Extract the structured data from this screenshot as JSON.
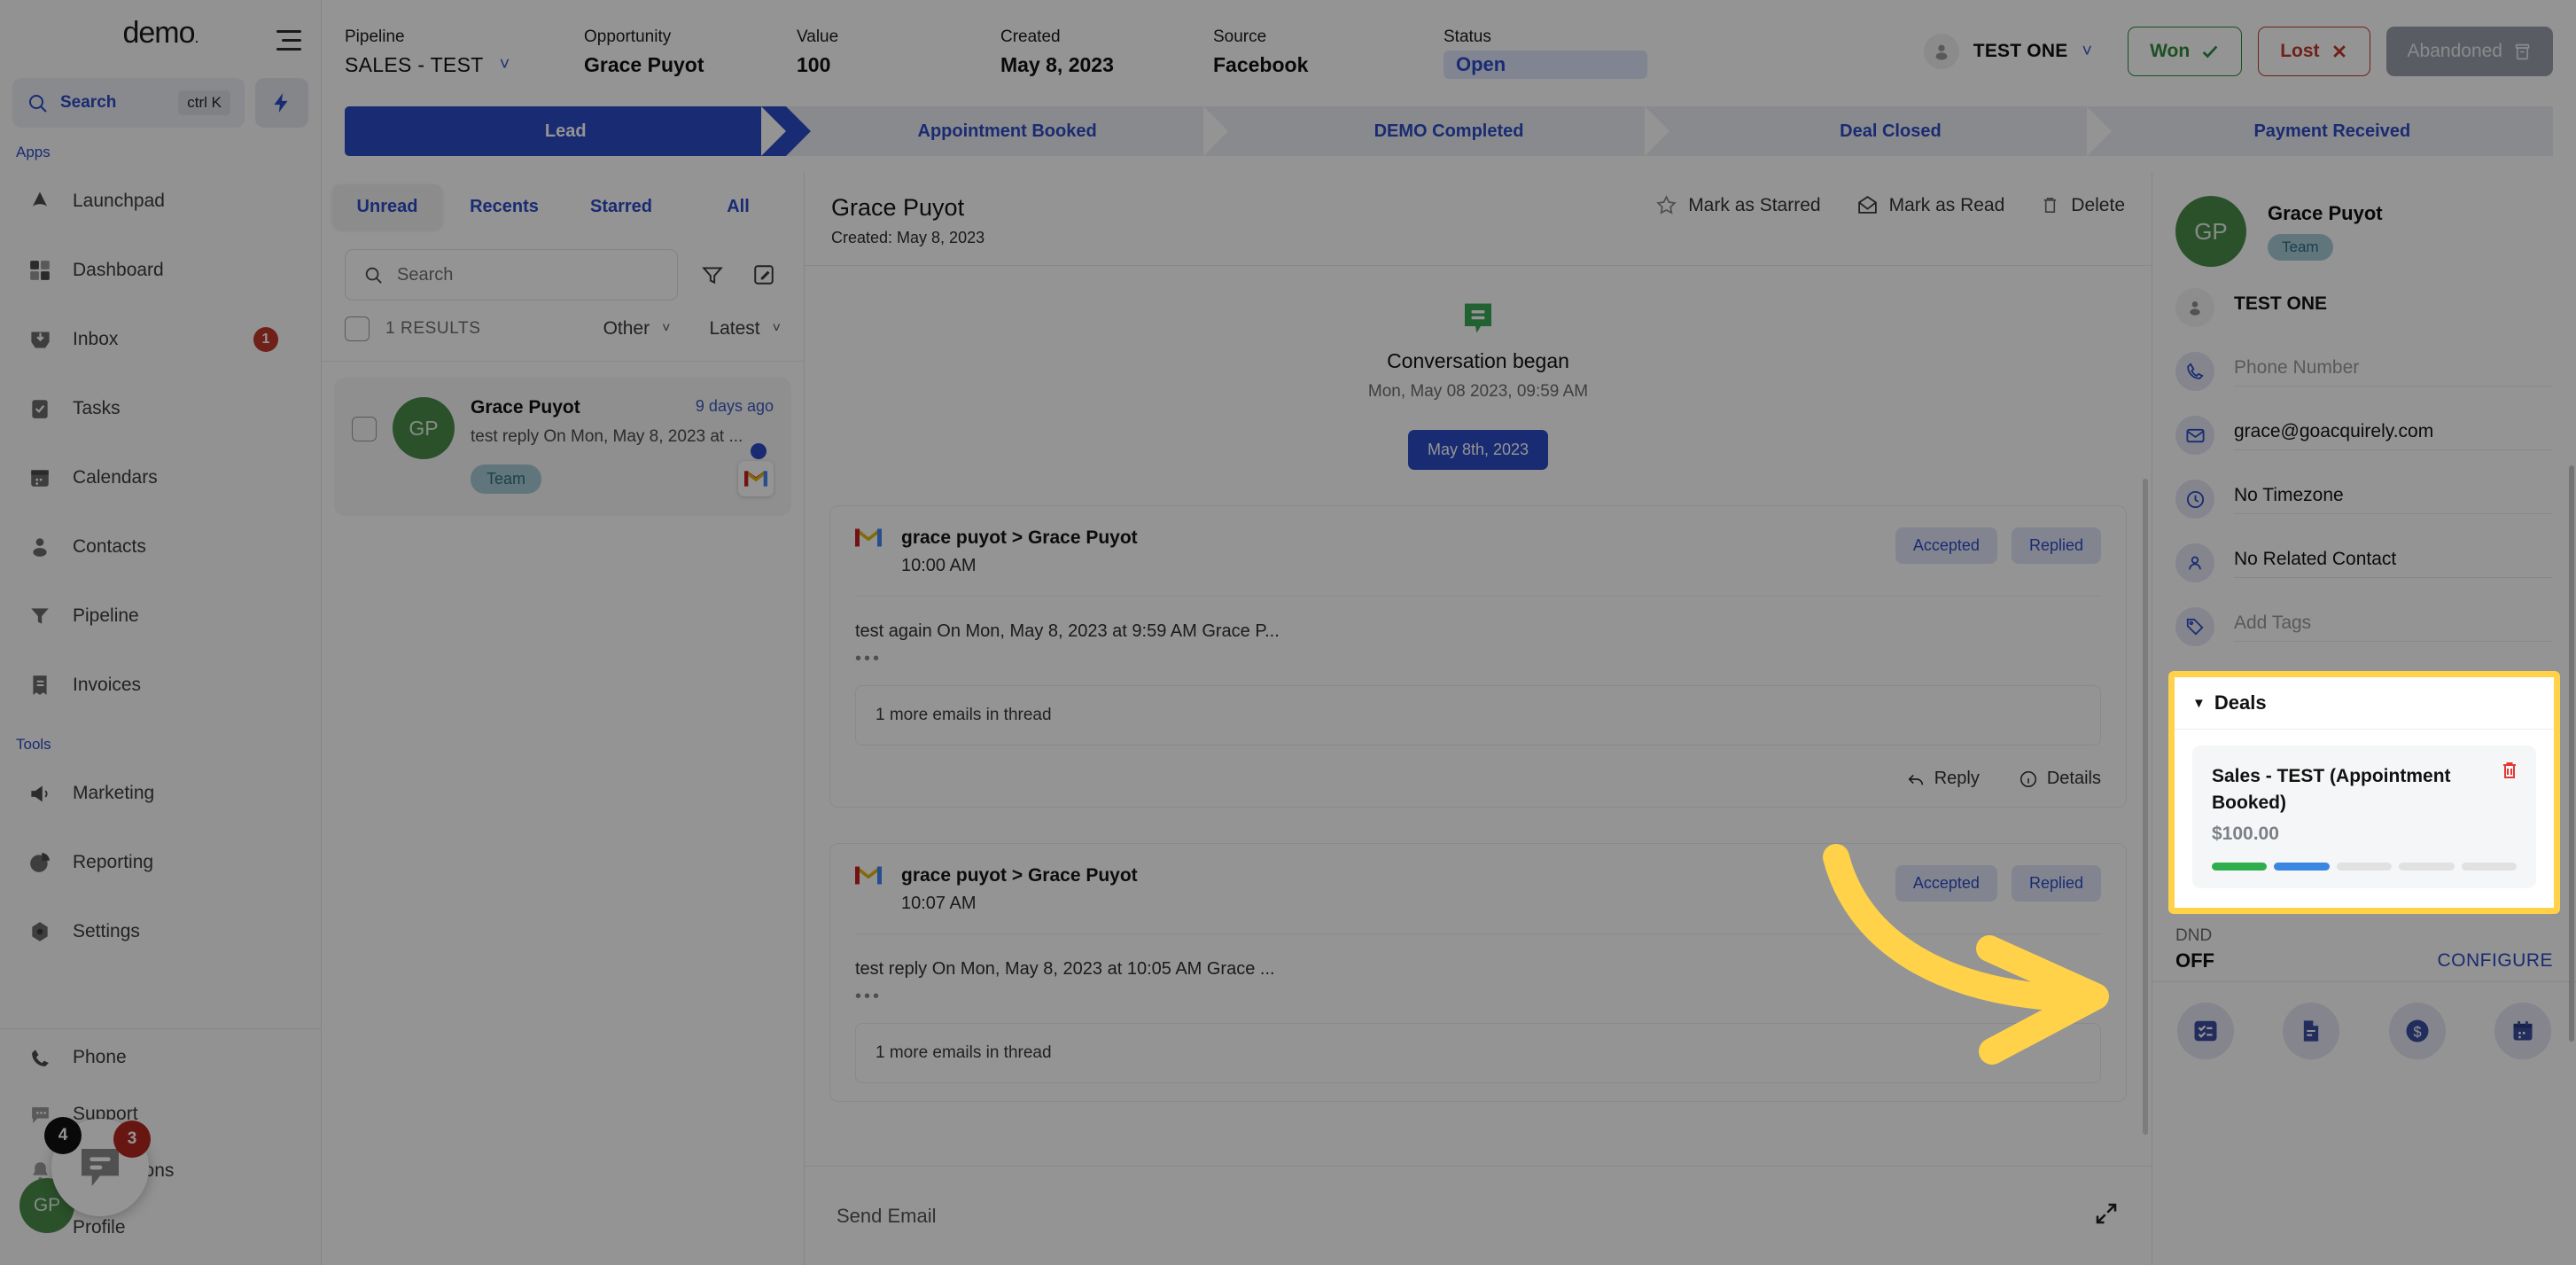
{
  "sidebar": {
    "brand": "demo",
    "search": {
      "label": "Search",
      "shortcut": "ctrl K"
    },
    "groups": [
      {
        "label": "Apps",
        "items": [
          {
            "label": "Launchpad",
            "icon": "launchpad-icon",
            "badge": ""
          },
          {
            "label": "Dashboard",
            "icon": "dashboard-icon",
            "badge": ""
          },
          {
            "label": "Inbox",
            "icon": "inbox-icon",
            "badge": "1"
          },
          {
            "label": "Tasks",
            "icon": "tasks-icon",
            "badge": ""
          },
          {
            "label": "Calendars",
            "icon": "calendar-icon",
            "badge": ""
          },
          {
            "label": "Contacts",
            "icon": "contacts-icon",
            "badge": ""
          },
          {
            "label": "Pipeline",
            "icon": "pipeline-icon",
            "badge": ""
          },
          {
            "label": "Invoices",
            "icon": "invoices-icon",
            "badge": ""
          }
        ]
      },
      {
        "label": "Tools",
        "items": [
          {
            "label": "Marketing",
            "icon": "megaphone-icon",
            "badge": ""
          },
          {
            "label": "Reporting",
            "icon": "pie-chart-icon",
            "badge": ""
          },
          {
            "label": "Settings",
            "icon": "gear-icon",
            "badge": ""
          }
        ]
      }
    ],
    "bottom_items": [
      {
        "label": "Phone",
        "icon": "phone-icon",
        "badge": ""
      },
      {
        "label": "Support",
        "icon": "support-chat-icon",
        "badge": ""
      },
      {
        "label": "Notifications",
        "icon": "bell-icon",
        "badge": ""
      },
      {
        "label": "Profile",
        "icon": "profile-icon",
        "badge": ""
      }
    ],
    "chat_widget": {
      "dark_count": "4",
      "red_count": "3",
      "avatar_initials": "GP"
    }
  },
  "topbar": {
    "pipeline": {
      "label": "Pipeline",
      "value": "SALES - TEST"
    },
    "opportunity": {
      "label": "Opportunity",
      "value": "Grace Puyot"
    },
    "value": {
      "label": "Value",
      "value": "100"
    },
    "created": {
      "label": "Created",
      "value": "May 8, 2023"
    },
    "source": {
      "label": "Source",
      "value": "Facebook"
    },
    "status": {
      "label": "Status",
      "value": "Open"
    },
    "owner": "TEST ONE",
    "won_label": "Won",
    "lost_label": "Lost",
    "abandoned_label": "Abandoned"
  },
  "stages": [
    {
      "label": "Lead",
      "active": true
    },
    {
      "label": "Appointment Booked",
      "active": false
    },
    {
      "label": "DEMO Completed",
      "active": false
    },
    {
      "label": "Deal Closed",
      "active": false
    },
    {
      "label": "Payment Received",
      "active": false
    }
  ],
  "conversations": {
    "tabs": [
      {
        "label": "Unread",
        "active": true
      },
      {
        "label": "Recents",
        "active": false
      },
      {
        "label": "Starred",
        "active": false
      },
      {
        "label": "All",
        "active": false
      }
    ],
    "search_placeholder": "Search",
    "results_count": "1 RESULTS",
    "filter_type": "Other",
    "sort": "Latest",
    "items": [
      {
        "initials": "GP",
        "name": "Grace Puyot",
        "time": "9 days ago",
        "preview": "test reply On Mon, May 8, 2023 at ...",
        "tag": "Team",
        "channel": "gmail-icon",
        "unread": true
      }
    ]
  },
  "thread": {
    "title": "Grace Puyot",
    "subtitle": "Created: May 8, 2023",
    "actions": [
      {
        "label": "Mark as Starred",
        "icon": "star-icon"
      },
      {
        "label": "Mark as Read",
        "icon": "envelope-open-icon"
      },
      {
        "label": "Delete",
        "icon": "trash-icon"
      }
    ],
    "conversation_began": {
      "title": "Conversation began",
      "timestamp": "Mon, May 08 2023, 09:59 AM"
    },
    "date_chip": "May 8th, 2023",
    "messages": [
      {
        "from": "grace puyot > Grace Puyot",
        "time": "10:00 AM",
        "chips": [
          "Accepted",
          "Replied"
        ],
        "body": "test again On Mon, May 8, 2023 at 9:59 AM Grace P...",
        "dots": "•••",
        "more": "1 more emails in thread",
        "footer": [
          {
            "label": "Reply",
            "icon": "reply-icon"
          },
          {
            "label": "Details",
            "icon": "info-icon"
          }
        ]
      },
      {
        "from": "grace puyot > Grace Puyot",
        "time": "10:07 AM",
        "chips": [
          "Accepted",
          "Replied"
        ],
        "body": "test reply On Mon, May 8, 2023 at 10:05 AM Grace ...",
        "dots": "•••",
        "more": "1 more emails in thread",
        "footer": []
      }
    ],
    "composer_placeholder": "Send Email"
  },
  "contact": {
    "initials": "GP",
    "name": "Grace Puyot",
    "tag": "Team",
    "owner": "TEST ONE",
    "phone_placeholder": "Phone Number",
    "email": "grace@goacquirely.com",
    "timezone": "No Timezone",
    "related_contact": "No Related Contact",
    "tags_placeholder": "Add Tags",
    "deals": {
      "header": "Deals",
      "items": [
        {
          "title": "Sales - TEST (Appointment Booked)",
          "amount": "$100.00",
          "progress_segments": [
            "green",
            "blue",
            "grey",
            "grey",
            "grey"
          ]
        }
      ]
    },
    "dnd": {
      "label": "DND",
      "value": "OFF",
      "configure": "CONFIGURE"
    },
    "quick_actions": [
      {
        "icon": "task-list-icon"
      },
      {
        "icon": "document-icon"
      },
      {
        "icon": "dollar-icon"
      },
      {
        "icon": "calendar-icon"
      }
    ]
  },
  "annotation": {
    "highlight_color": "#ffd24a",
    "arrow_color": "#ffd24a",
    "target": "Deals"
  }
}
